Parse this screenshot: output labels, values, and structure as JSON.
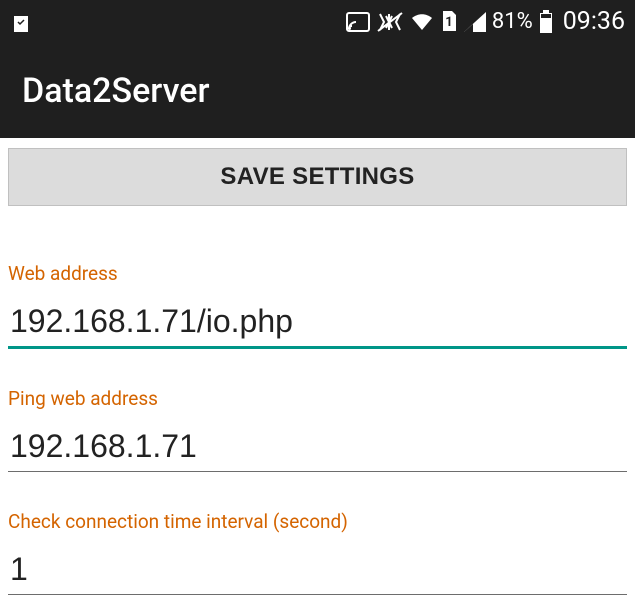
{
  "status": {
    "battery_percent": "81%",
    "clock": "09:36"
  },
  "header": {
    "title": "Data2Server"
  },
  "actions": {
    "save_label": "SAVE SETTINGS"
  },
  "fields": {
    "web_address": {
      "label": "Web address",
      "value": "192.168.1.71/io.php"
    },
    "ping_address": {
      "label": "Ping web address",
      "value": "192.168.1.71"
    },
    "check_interval": {
      "label": "Check connection time interval (second)",
      "value": "1"
    }
  }
}
